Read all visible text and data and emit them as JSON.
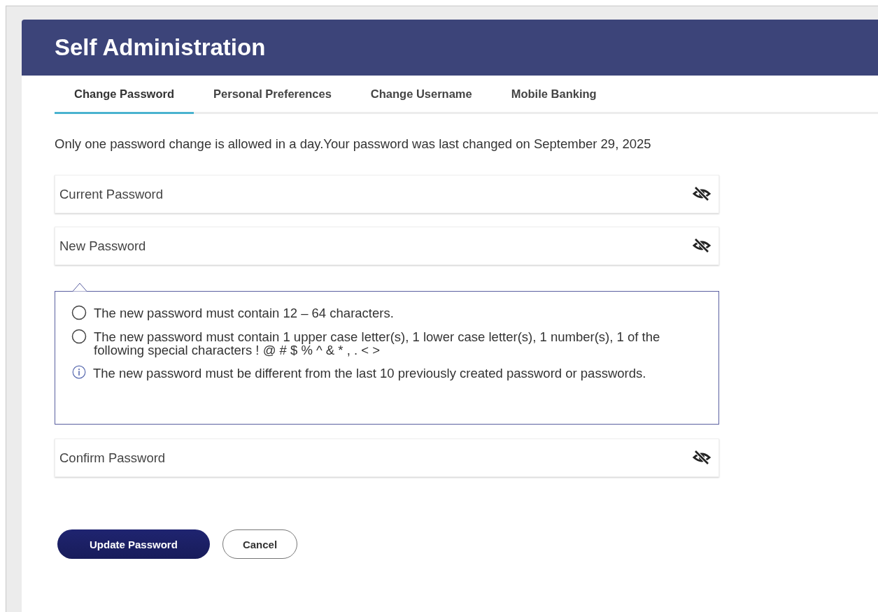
{
  "header": {
    "title": "Self Administration"
  },
  "tabs": [
    {
      "label": "Change Password",
      "selected": true
    },
    {
      "label": "Personal Preferences",
      "selected": false
    },
    {
      "label": "Change Username",
      "selected": false
    },
    {
      "label": "Mobile Banking",
      "selected": false
    }
  ],
  "notice": "Only one password change is allowed in a day.Your password was last changed on September 29, 2025",
  "fields": [
    {
      "placeholder": "Current Password",
      "visible": false
    },
    {
      "placeholder": "New Password",
      "visible": false
    }
  ],
  "rules": [
    {
      "kind": "check",
      "text": "The new password must contain 12 – 64 characters.",
      "met": false
    },
    {
      "kind": "check",
      "text": "The new password must contain 1 upper case letter(s), 1 lower case letter(s), 1 number(s), 1 of the following special characters ! @ # $ % ^ & * , . < >",
      "met": false
    },
    {
      "kind": "info",
      "text": "The new password must be different from the last 10 previously created password or passwords."
    }
  ],
  "confirm_field": {
    "placeholder": "Confirm Password",
    "visible": false
  },
  "buttons": [
    {
      "label": "Update Password",
      "kind": "primary"
    },
    {
      "label": "Cancel",
      "kind": "secondary"
    }
  ]
}
